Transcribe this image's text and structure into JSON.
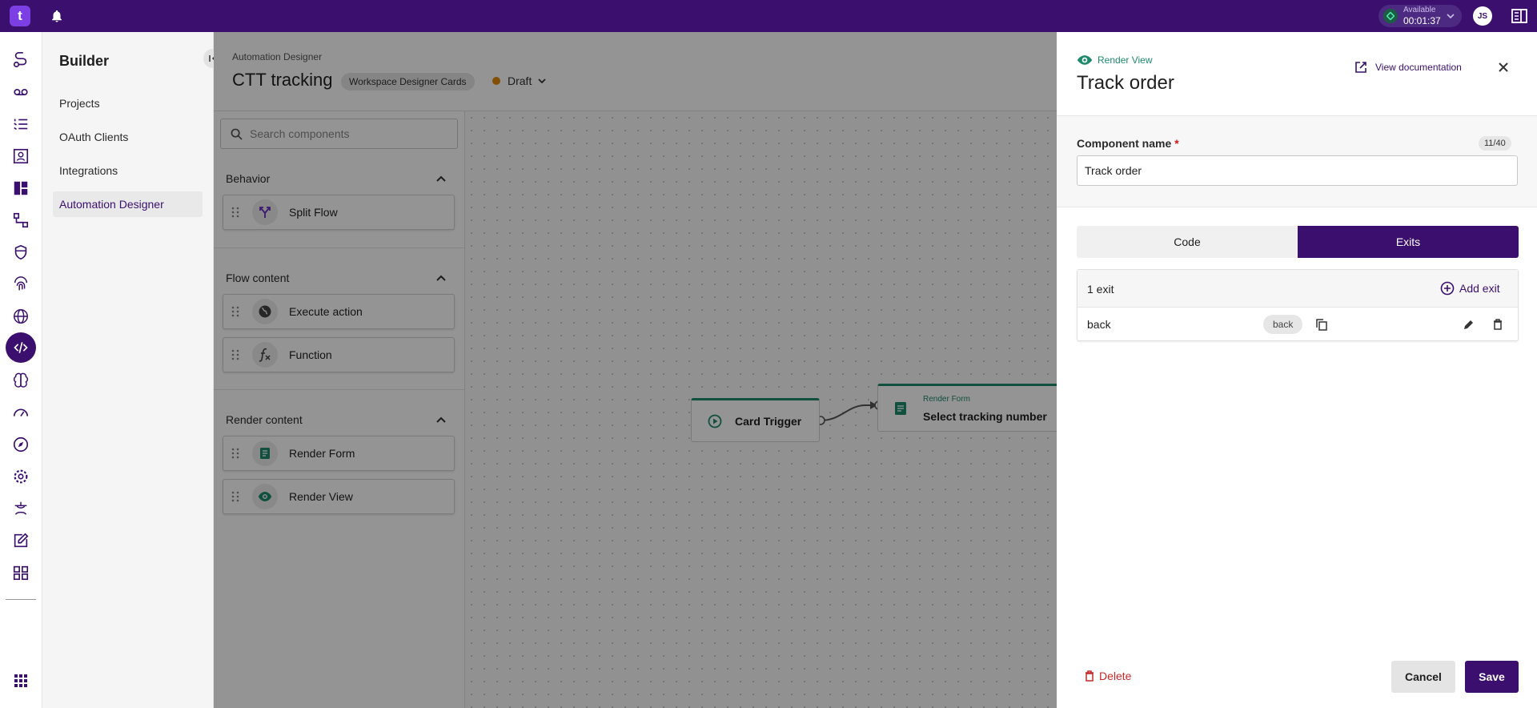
{
  "topbar": {
    "logo": "t",
    "status_label": "Available",
    "status_time": "00:01:37",
    "avatar_initials": "JS"
  },
  "rail": {
    "icons": [
      "routing-icon",
      "voicemail-icon",
      "list-icon",
      "contacts-icon",
      "dashboard-icon",
      "flow-icon",
      "shield-icon",
      "fingerprint-icon",
      "globe-icon",
      "code-icon",
      "brain-icon",
      "speed-icon",
      "compass-icon",
      "gear-icon",
      "agent-icon",
      "edit-icon",
      "grid-icon",
      "apps-icon"
    ],
    "active": "code-icon"
  },
  "nav": {
    "title": "Builder",
    "items": [
      {
        "label": "Projects"
      },
      {
        "label": "OAuth Clients"
      },
      {
        "label": "Integrations"
      },
      {
        "label": "Automation Designer",
        "active": true
      }
    ]
  },
  "main": {
    "breadcrumb": "Automation Designer",
    "title": "CTT tracking",
    "workspace_badge": "Workspace Designer Cards",
    "status": "Draft",
    "search_placeholder": "Search components",
    "sections": [
      {
        "title": "Behavior",
        "items": [
          {
            "label": "Split Flow",
            "icon": "split-icon"
          }
        ]
      },
      {
        "title": "Flow content",
        "items": [
          {
            "label": "Execute action",
            "icon": "globe-icon"
          },
          {
            "label": "Function",
            "icon": "function-icon"
          }
        ]
      },
      {
        "title": "Render content",
        "items": [
          {
            "label": "Render Form",
            "icon": "form-icon"
          },
          {
            "label": "Render View",
            "icon": "eye-icon"
          }
        ]
      }
    ],
    "canvas": {
      "trigger_label": "Card Trigger",
      "form_type": "Render Form",
      "form_label": "Select tracking number"
    }
  },
  "drawer": {
    "type_label": "Render View",
    "title": "Track order",
    "doc_link": "View documentation",
    "name_label": "Component name",
    "required_mark": "*",
    "counter": "11/40",
    "name_value": "Track order",
    "tabs": [
      "Code",
      "Exits"
    ],
    "active_tab": "Exits",
    "exits_count": "1 exit",
    "add_exit": "Add exit",
    "exits": [
      {
        "name": "back",
        "tag": "back"
      }
    ],
    "delete_label": "Delete",
    "cancel_label": "Cancel",
    "save_label": "Save"
  },
  "colors": {
    "brand": "#3a0f6e",
    "accent_teal": "#1e8a6c",
    "danger": "#c62828",
    "draft": "#e08a00"
  }
}
